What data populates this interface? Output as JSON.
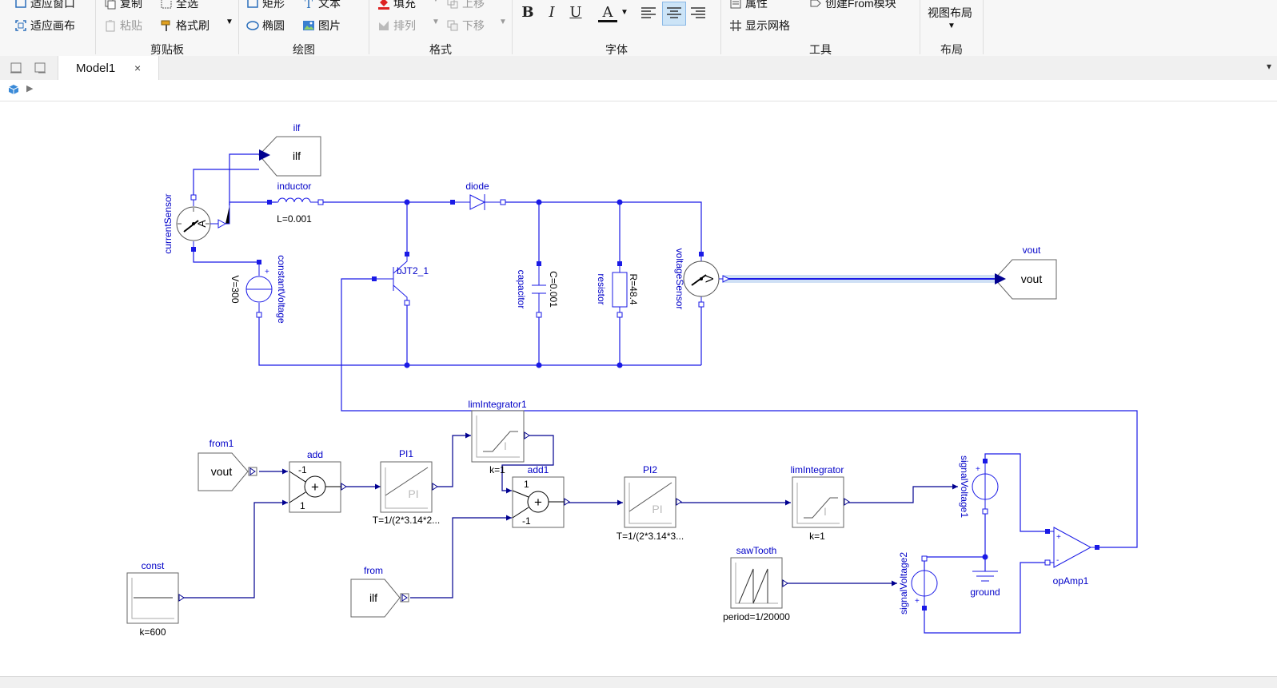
{
  "ribbon": {
    "view": {
      "fit_window": "适应窗口",
      "fit_canvas": "适应画布"
    },
    "clipboard": {
      "title": "剪贴板",
      "copy": "复制",
      "select_all": "全选",
      "paste": "粘贴",
      "format_painter": "格式刷"
    },
    "draw": {
      "title": "绘图",
      "rect": "矩形",
      "text": "文本",
      "ellipse": "椭圆",
      "picture": "图片"
    },
    "format": {
      "title": "格式",
      "fill": "填充",
      "move_up": "上移",
      "arrange": "排列",
      "move_down": "下移"
    },
    "font": {
      "title": "字体",
      "bold": "B",
      "italic": "I",
      "underline": "U",
      "color": "A"
    },
    "tools": {
      "title": "工具",
      "properties": "属性",
      "create_from": "创建From模块",
      "show_grid": "显示网格"
    },
    "layout": {
      "title": "布局",
      "view_layout": "视图布局"
    }
  },
  "tabs": [
    {
      "label": "Model1",
      "close": "×"
    }
  ],
  "diagram": {
    "ilf_top": {
      "name": "ilf",
      "text": "ilf"
    },
    "inductor": {
      "name": "inductor",
      "param": "L=0.001"
    },
    "diode": {
      "name": "diode"
    },
    "current_sensor": {
      "name": "currentSensor",
      "glyph": "A"
    },
    "constant_voltage": {
      "name": "constantVoltage",
      "param": "V=300"
    },
    "bjt": {
      "name": "bJT2_1"
    },
    "capacitor": {
      "name": "capacitor",
      "param": "C=0.001"
    },
    "resistor": {
      "name": "resistor",
      "param": "R=48.4"
    },
    "voltage_sensor": {
      "name": "voltageSensor",
      "glyph": "V"
    },
    "vout_top": {
      "name": "vout",
      "text": "vout"
    },
    "from1": {
      "name": "from1",
      "text": "vout"
    },
    "add": {
      "name": "add",
      "in1": "-1",
      "in2": "1"
    },
    "pi1": {
      "name": "PI1",
      "param": "T=1/(2*3.14*2...",
      "glyph": "PI"
    },
    "lim_integrator1": {
      "name": "limIntegrator1",
      "param": "k=1",
      "glyph": "I"
    },
    "add1": {
      "name": "add1",
      "in1": "1",
      "in2": "-1"
    },
    "pi2": {
      "name": "PI2",
      "param": "T=1/(2*3.14*3...",
      "glyph": "PI"
    },
    "lim_integrator": {
      "name": "limIntegrator",
      "param": "k=1",
      "glyph": "I"
    },
    "signal_voltage1": {
      "name": "signalVoltage1"
    },
    "op_amp1": {
      "name": "opAmp1"
    },
    "ground": {
      "name": "ground"
    },
    "const": {
      "name": "const",
      "param": "k=600"
    },
    "from": {
      "name": "from",
      "text": "ilf"
    },
    "saw_tooth": {
      "name": "sawTooth",
      "param": "period=1/20000"
    },
    "signal_voltage2": {
      "name": "signalVoltage2"
    },
    "plus": "+",
    "minus": "-",
    "sum": "+"
  },
  "colors": {
    "wire": "#1a1ae6",
    "port": "#0000c8",
    "selected": "#a8c8f0",
    "accent": "#cce4f7"
  }
}
